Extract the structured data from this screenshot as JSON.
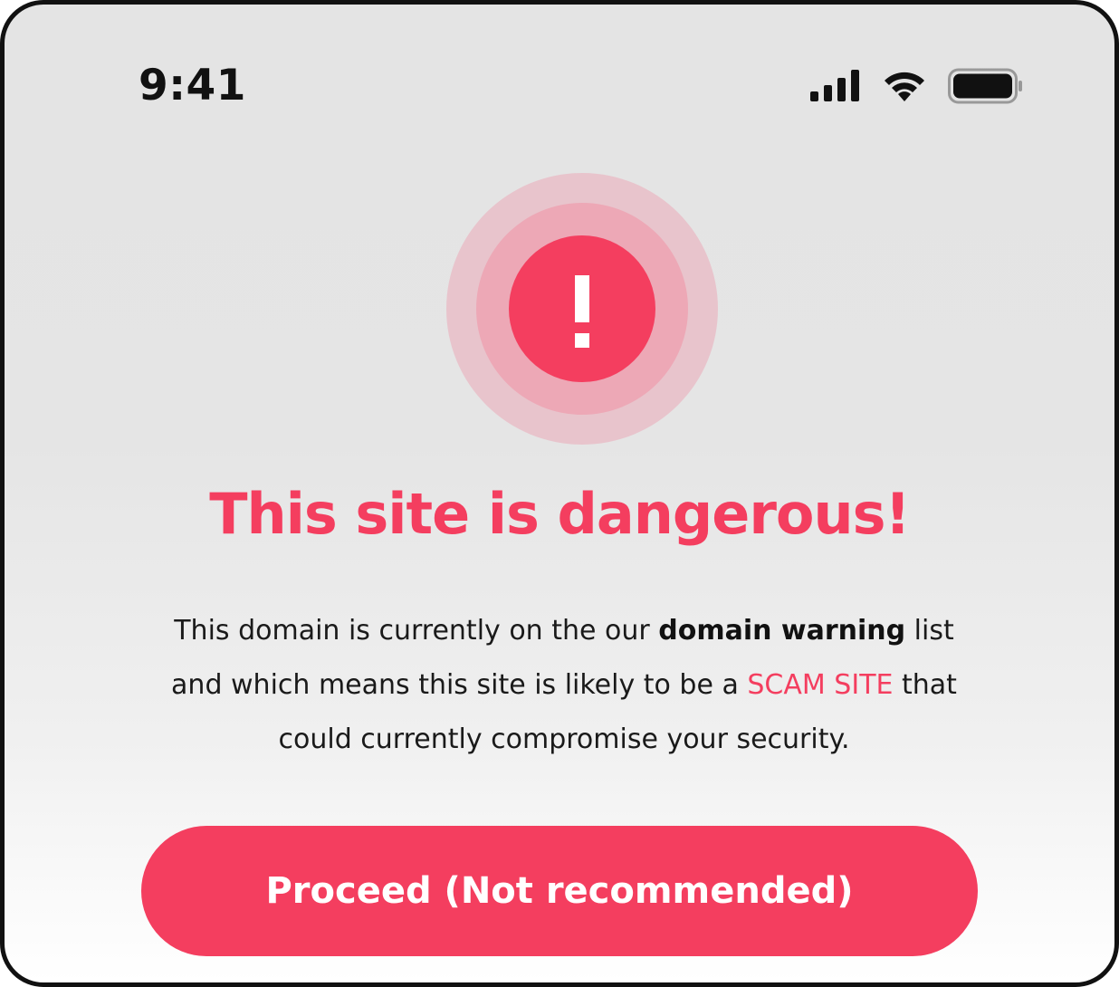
{
  "status_bar": {
    "time": "9:41",
    "icons": [
      "cellular-signal-icon",
      "wifi-icon",
      "battery-icon"
    ]
  },
  "alert": {
    "icon": "exclamation-icon",
    "symbol": "!"
  },
  "title": "This site is dangerous!",
  "description": {
    "part1": "This domain is currently on the our ",
    "bold": "domain warning",
    "part2": " list and which means this site is likely to be a ",
    "highlight": "SCAM SITE",
    "part3": " that could currently compromise your security."
  },
  "button": {
    "label": "Proceed (Not recommended)"
  },
  "colors": {
    "accent": "#f43e5f",
    "ring_mid": "#eda8b6",
    "ring_outer": "#e8c4cc",
    "text": "#1a1a1a"
  }
}
